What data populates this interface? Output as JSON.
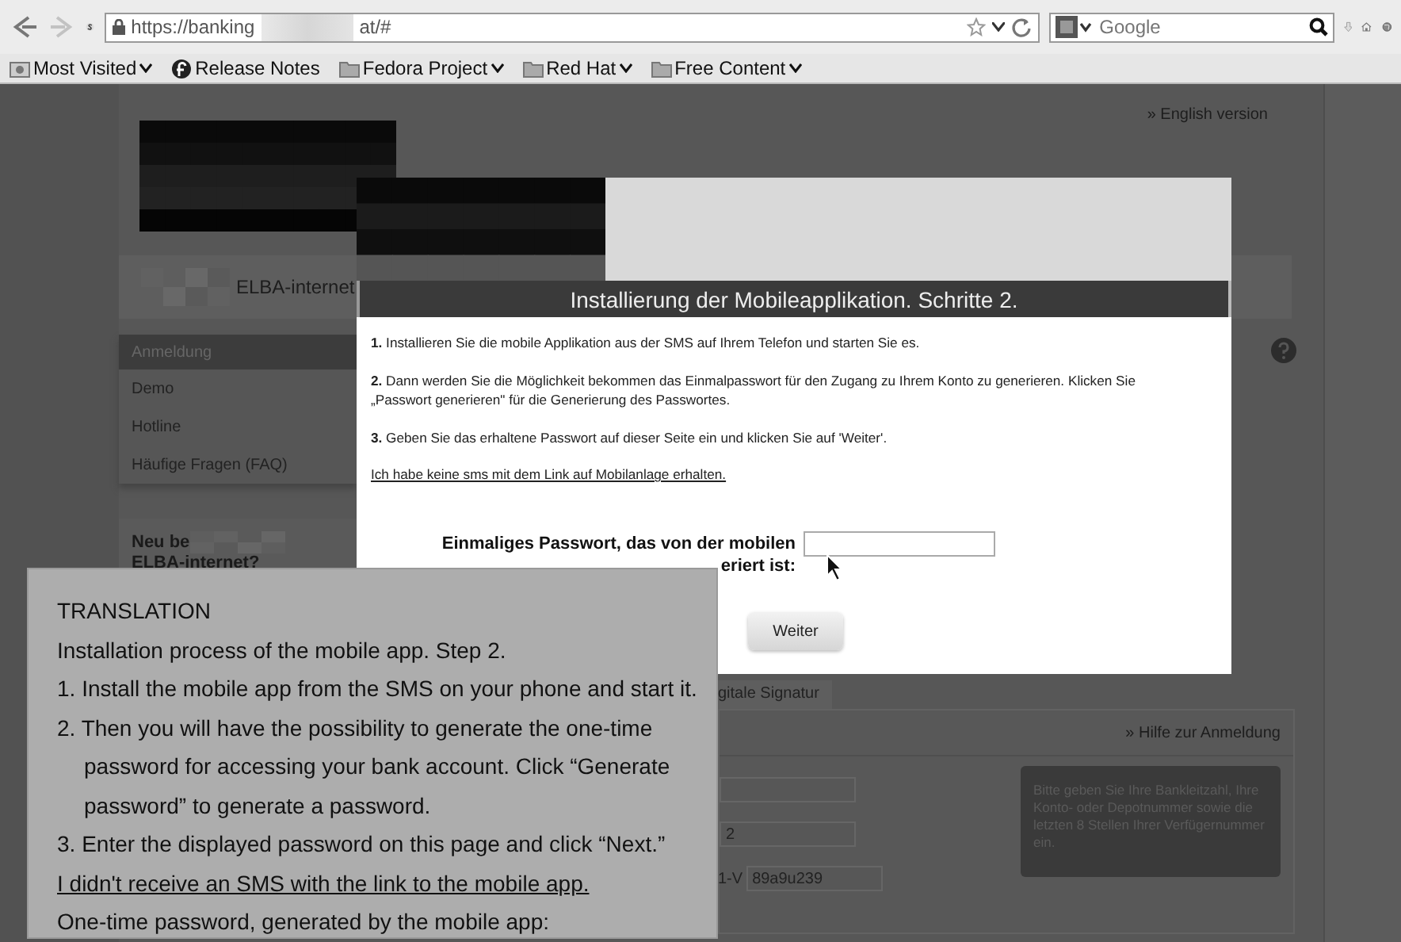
{
  "browser": {
    "nav_buttons": [
      {
        "kind": "back",
        "disabled": false
      },
      {
        "kind": "forward",
        "disabled": true
      }
    ],
    "url_parts": [
      "https://banking",
      "at/#"
    ],
    "search": {
      "placeholder": "Google"
    },
    "bookmarks": [
      {
        "kind": "history",
        "label": "Most Visited",
        "menu": true
      },
      {
        "kind": "fedora",
        "label": "Release Notes",
        "menu": false
      },
      {
        "kind": "folder",
        "label": "Fedora Project",
        "menu": true
      },
      {
        "kind": "folder",
        "label": "Red Hat",
        "menu": true
      },
      {
        "kind": "folder",
        "label": "Free Content",
        "menu": true
      }
    ]
  },
  "page": {
    "language_link": "» English version",
    "brand": "ELBA-internet",
    "sidebar": {
      "items": [
        {
          "label": "Anmeldung",
          "selected": true
        },
        {
          "label": "Demo",
          "selected": false
        },
        {
          "label": "Hotline",
          "selected": false
        },
        {
          "label": "Häufige Fragen (FAQ)",
          "selected": false
        }
      ]
    },
    "promo": [
      "Neu be",
      "ELBA-internet?"
    ],
    "tab": "gitale Signatur",
    "help_link": "» Hilfe zur Anmeldung",
    "fields": [
      {
        "kind": "plain"
      },
      {
        "kind": "plain",
        "value": "2"
      },
      {
        "kind": "labeled",
        "label": "1-V",
        "value": "89a9u239"
      }
    ],
    "hint": "Bitte geben Sie Ihre Bankleitzahl, Ihre Konto- oder Depotnummer sowie die letzten 8 Stellen Ihrer Verfügernummer ein."
  },
  "dialog": {
    "title": "Installierung der Mobileapplikation. Schritte 2.",
    "steps": [
      "**1.** Installieren Sie die mobile Applikation aus der SMS auf Ihrem Telefon und starten Sie es.",
      "**2.** Dann werden Sie die Möglichkeit bekommen das Einmalpasswort für den Zugang zu Ihrem Konto zu generieren. Klicken Sie „Passwort generieren\" für die Generierung des Passwortes.",
      "**3.** Geben Sie das erhaltene Passwort auf dieser Seite ein und klicken Sie auf 'Weiter'."
    ],
    "link": "Ich habe keine sms mit dem Link auf Mobilanlage erhalten.",
    "password_label": [
      "Einmaliges Passwort, das von der mobilen",
      "eriert ist:"
    ],
    "button": "Weiter"
  },
  "translation": {
    "heading": "TRANSLATION",
    "lines": [
      {
        "kind": "text",
        "text": "Installation process of the mobile app. Step 2."
      },
      {
        "kind": "step",
        "text": "1. Install the mobile app from the SMS on your phone and start it."
      },
      {
        "kind": "step",
        "text": "2. Then you will have the possibility to generate the one-time password for accessing your bank account. Click “Generate password” to generate a password."
      },
      {
        "kind": "step",
        "text": "3. Enter the displayed password on this page and click “Next.”"
      },
      {
        "kind": "link",
        "text": "I didn't receive an SMS with the link to the mobile app."
      },
      {
        "kind": "text",
        "text": "One-time password, generated by the mobile app:"
      }
    ]
  }
}
